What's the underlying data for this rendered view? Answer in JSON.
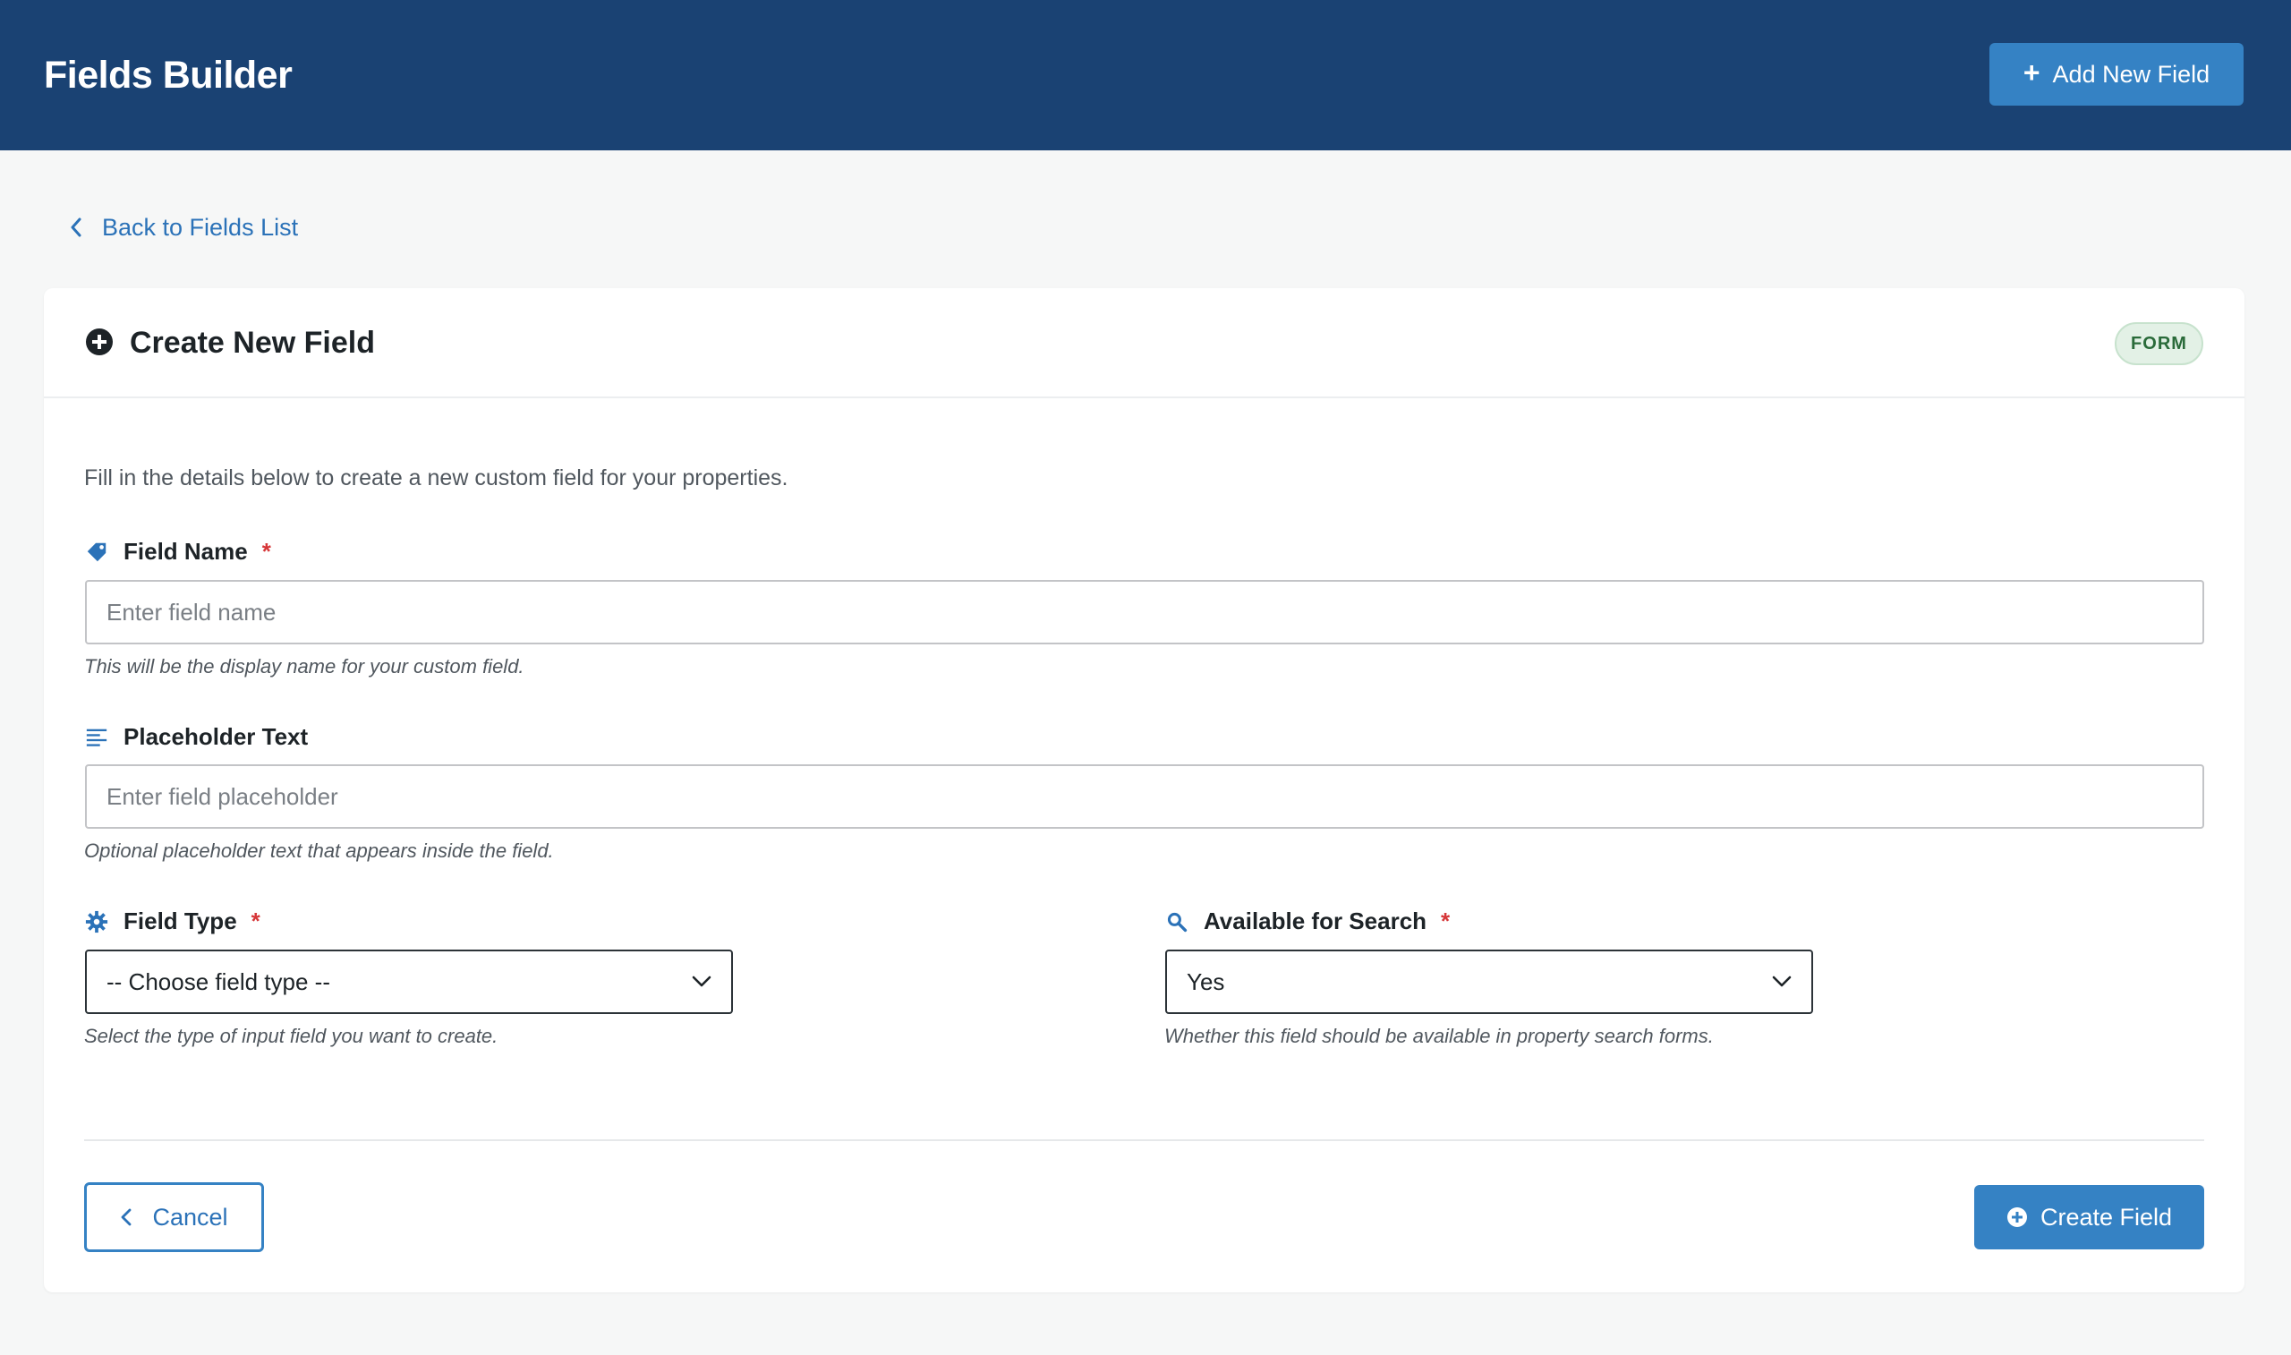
{
  "header": {
    "title": "Fields Builder",
    "add_button_label": "Add New Field",
    "add_button_icon": "plus-icon"
  },
  "back_link": {
    "label": "Back to Fields List",
    "icon": "chevron-left-icon"
  },
  "card": {
    "title": "Create New Field",
    "title_icon": "plus-circle-icon",
    "badge": "FORM",
    "intro": "Fill in the details below to create a new custom field for your properties."
  },
  "fields": {
    "field_name": {
      "label": "Field Name",
      "required_mark": "*",
      "icon": "tag-icon",
      "value": "",
      "placeholder": "Enter field name",
      "help": "This will be the display name for your custom field."
    },
    "placeholder_text": {
      "label": "Placeholder Text",
      "icon": "text-lines-icon",
      "value": "",
      "placeholder": "Enter field placeholder",
      "help": "Optional placeholder text that appears inside the field."
    },
    "field_type": {
      "label": "Field Type",
      "required_mark": "*",
      "icon": "gear-icon",
      "selected": "-- Choose field type --",
      "help": "Select the type of input field you want to create."
    },
    "available_for_search": {
      "label": "Available for Search",
      "required_mark": "*",
      "icon": "search-icon",
      "selected": "Yes",
      "help": "Whether this field should be available in property search forms."
    }
  },
  "actions": {
    "cancel_label": "Cancel",
    "create_label": "Create Field"
  },
  "colors": {
    "header_bg": "#1a4273",
    "primary": "#3582c4",
    "link": "#2b72b8",
    "required": "#d63638",
    "badge_bg": "#e3f1e6",
    "badge_text": "#2a6b3a",
    "page_bg": "#f6f7f7"
  }
}
